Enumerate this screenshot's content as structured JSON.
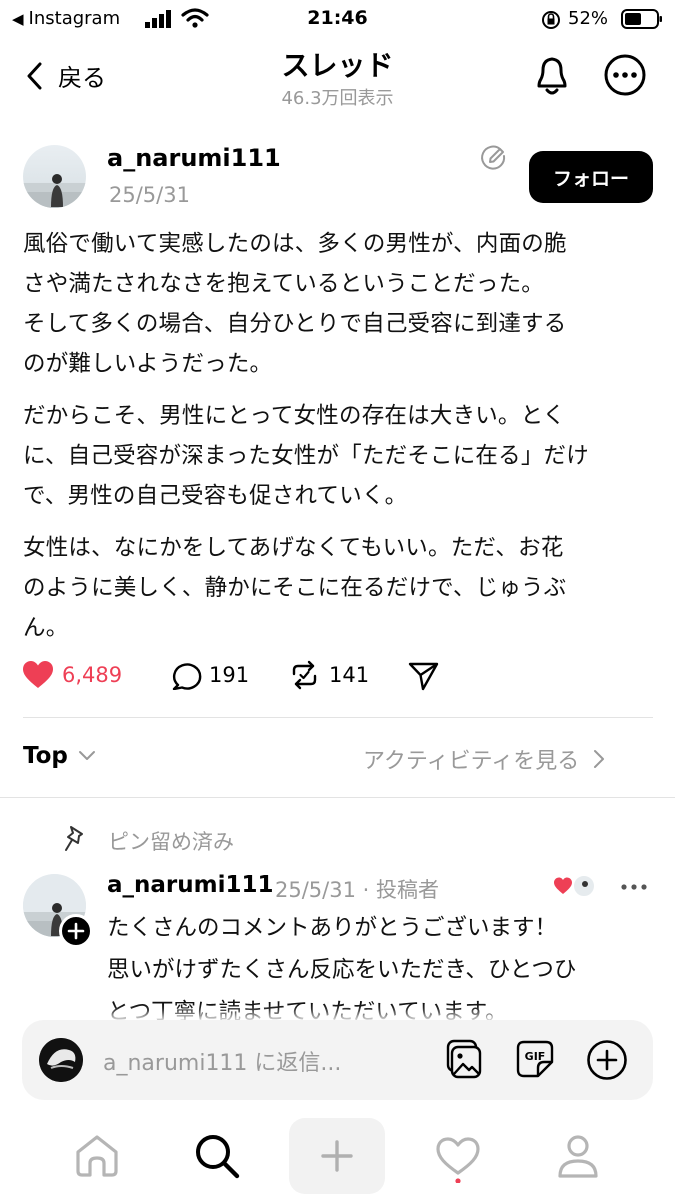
{
  "status_bar": {
    "back_app": "Instagram",
    "time": "21:46",
    "battery": "52%"
  },
  "header": {
    "back_label": "戻る",
    "title": "スレッド",
    "views": "46.3万回表示"
  },
  "post": {
    "username": "a_narumi111",
    "date": "25/5/31",
    "follow_label": "フォロー",
    "paragraphs": [
      [
        "風俗で働いて実感したのは、多くの男性が、内面の脆",
        "さや満たされなさを抱えているということだった。",
        "そして多くの場合、自分ひとりで自己受容に到達する",
        "のが難しいようだった。"
      ],
      [
        "だからこそ、男性にとって女性の存在は大きい。とく",
        "に、自己受容が深まった女性が「ただそこに在る」だけ",
        "で、男性の自己受容も促されていく。"
      ],
      [
        "女性は、なにかをしてあげなくてもいい。ただ、お花",
        "のように美しく、静かにそこに在るだけで、じゅうぶ",
        "ん。"
      ]
    ],
    "likes": "6,489",
    "comments": "191",
    "reposts": "141"
  },
  "sort": {
    "label": "Top",
    "activity_label": "アクティビティを見る"
  },
  "pinned_reply": {
    "pinned_label": "ピン留め済み",
    "username": "a_narumi111",
    "meta": "25/5/31 · 投稿者",
    "lines": [
      "たくさんのコメントありがとうございます！",
      "思いがけずたくさん反応をいただき、ひとつひ",
      "とつ丁寧に読ませていただいています。"
    ]
  },
  "composer": {
    "placeholder": "a_narumi111 に返信..."
  },
  "colors": {
    "like": "#ee3f55",
    "muted": "#999999"
  },
  "icons": [
    "back-chevron-icon",
    "bell-icon",
    "more-icon",
    "edit-icon",
    "heart-icon",
    "comment-icon",
    "repost-icon",
    "share-icon",
    "pin-icon",
    "home-icon",
    "search-icon",
    "plus-icon",
    "activity-icon",
    "profile-icon",
    "image-icon",
    "gif-icon",
    "add-icon"
  ]
}
